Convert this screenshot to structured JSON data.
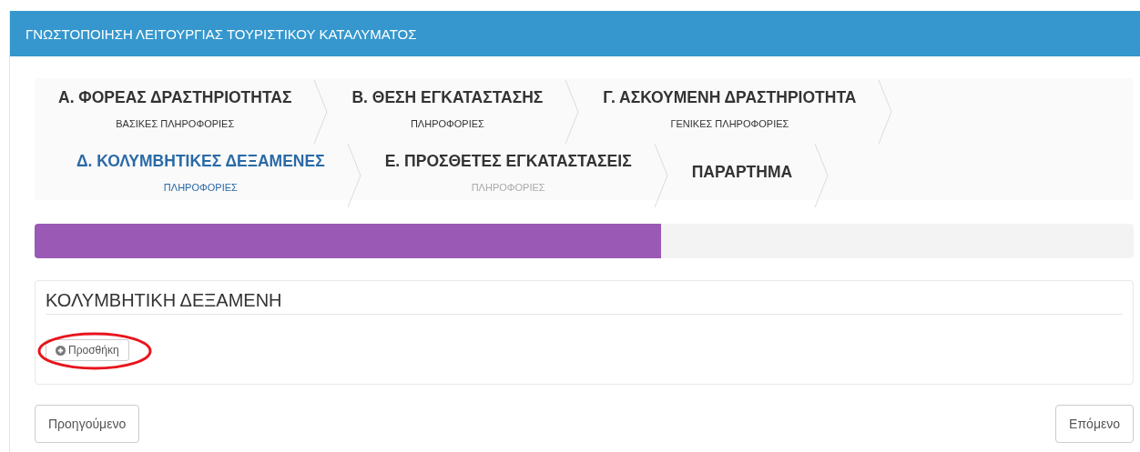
{
  "header": {
    "title": "ΓΝΩΣΤΟΠΟΙΗΣΗ ΛΕΙΤΟΥΡΓΙΑΣ ΤΟΥΡΙΣΤΙΚΟΥ ΚΑΤΑΛΥΜΑΤΟΣ"
  },
  "steps": [
    {
      "title": "Α. ΦΟΡΕΑΣ ΔΡΑΣΤΗΡΙΟΤΗΤΑΣ",
      "subtitle": "ΒΑΣΙΚΕΣ ΠΛΗΡΟΦΟΡΙΕΣ",
      "selected": false,
      "completed": true
    },
    {
      "title": "Β. ΘΕΣΗ ΕΓΚΑΤΑΣΤΑΣΗΣ",
      "subtitle": "ΠΛΗΡΟΦΟΡΙΕΣ",
      "selected": false,
      "completed": true
    },
    {
      "title": "Γ. ΑΣΚΟΥΜΕΝΗ ΔΡΑΣΤΗΡΙΟΤΗΤΑ",
      "subtitle": "ΓΕΝΙΚΕΣ ΠΛΗΡΟΦΟΡΙΕΣ",
      "selected": false,
      "completed": true
    },
    {
      "title": "Δ. ΚΟΛΥΜΒΗΤΙΚΕΣ ΔΕΞΑΜΕΝΕΣ",
      "subtitle": "ΠΛΗΡΟΦΟΡΙΕΣ",
      "selected": true
    },
    {
      "title": "Ε. ΠΡΟΣΘΕΤΕΣ ΕΓΚΑΤΑΣΤΑΣΕΙΣ",
      "subtitle": "ΠΛΗΡΟΦΟΡΙΕΣ",
      "selected": false,
      "completed": false
    },
    {
      "title": "ΠΑΡΑΡΤΗΜΑ",
      "selected": false
    }
  ],
  "progress": {
    "level": 0.57
  },
  "section": {
    "title": "ΚΟΛΥΜΒΗΤΙΚΗ ΔΕΞΑΜΕΝΗ",
    "add_button": {
      "label": "Προσθήκη",
      "circled": true
    }
  },
  "buttons": {
    "previous": "Προηγούμενο",
    "next": "Επόμενο"
  }
}
